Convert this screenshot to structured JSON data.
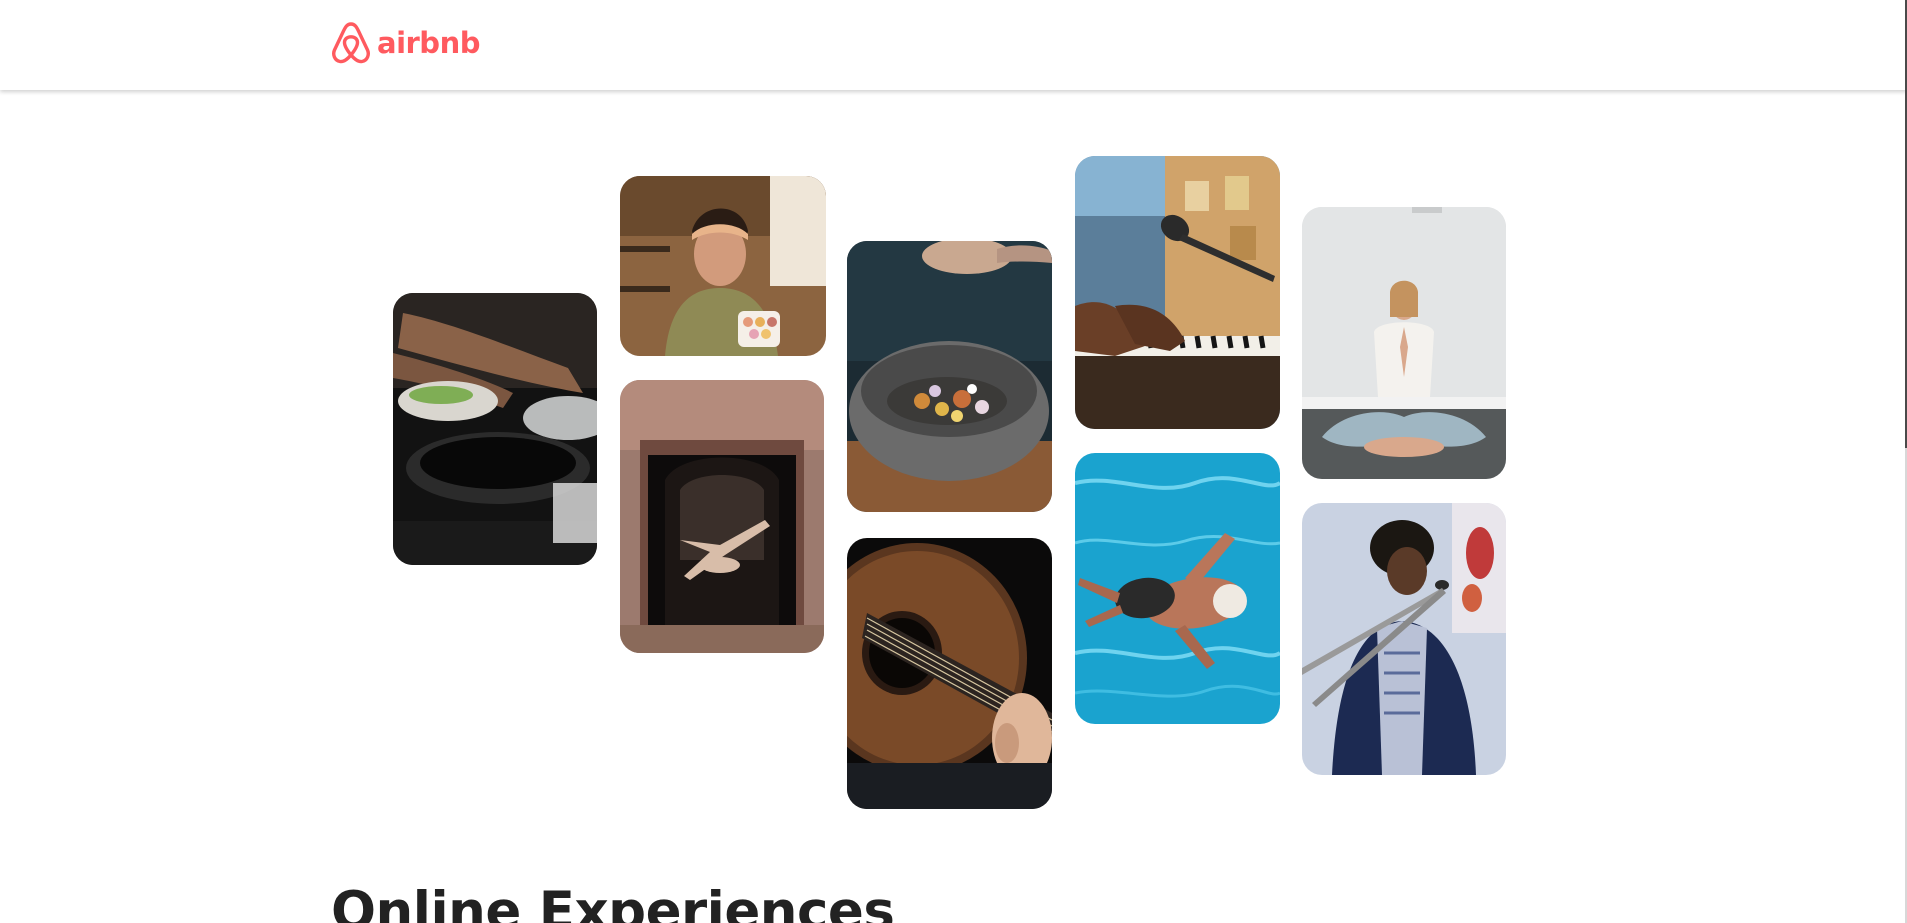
{
  "header": {
    "logo_text": "airbnb",
    "logo_icon": "airbnb-belo-icon",
    "brand_color": "#ff5a5f"
  },
  "photos": [
    {
      "subject": "cooking-pans-photo"
    },
    {
      "subject": "woman-with-macarons-photo"
    },
    {
      "subject": "dancer-in-archway-photo"
    },
    {
      "subject": "seasoning-stone-bowl-photo"
    },
    {
      "subject": "acoustic-guitar-photo"
    },
    {
      "subject": "piano-and-microphone-photo"
    },
    {
      "subject": "swimmer-in-pool-photo"
    },
    {
      "subject": "meditation-yoga-photo"
    },
    {
      "subject": "singer-with-microphone-photo"
    }
  ],
  "main": {
    "title": "Online Experiences"
  },
  "colors": {
    "text": "#222222",
    "background": "#ffffff"
  }
}
